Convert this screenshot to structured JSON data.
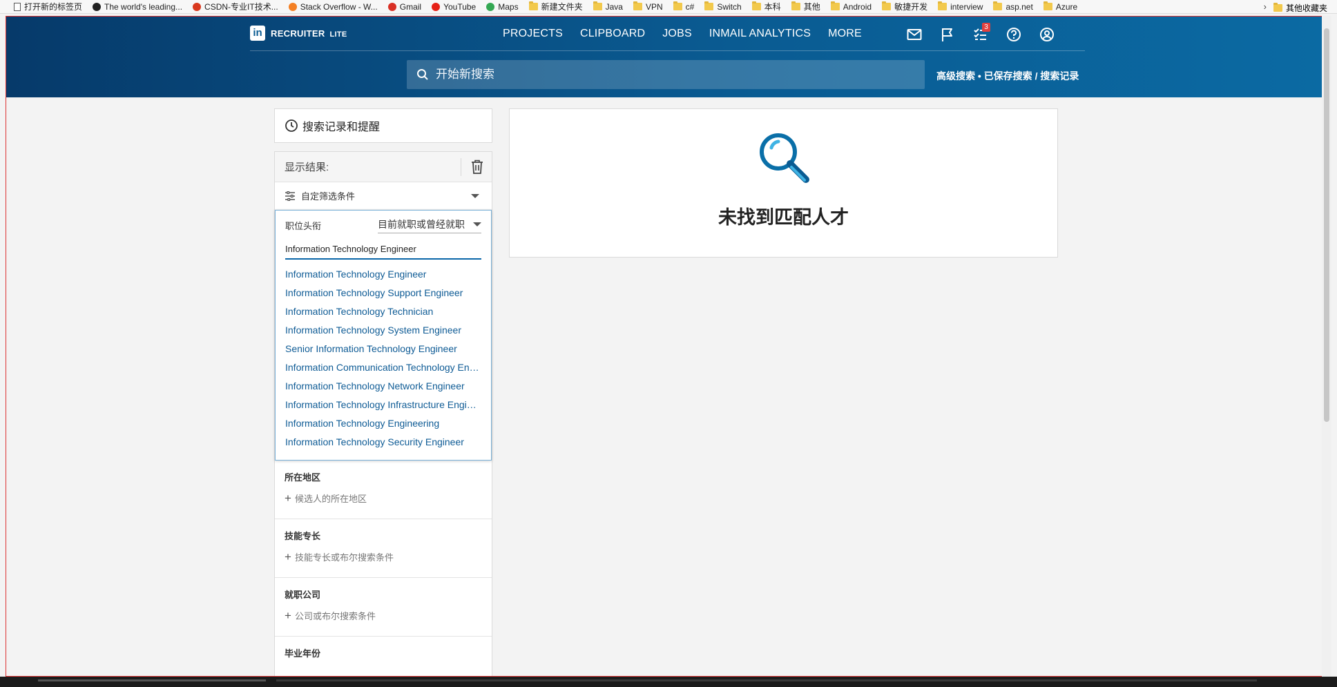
{
  "bookmarks": [
    {
      "label": "打开新的标签页",
      "icon": "page-icon"
    },
    {
      "label": "The world's leading...",
      "icon": "github-icon"
    },
    {
      "label": "CSDN-专业IT技术...",
      "icon": "csdn-icon"
    },
    {
      "label": "Stack Overflow - W...",
      "icon": "stackoverflow-icon"
    },
    {
      "label": "Gmail",
      "icon": "gmail-icon"
    },
    {
      "label": "YouTube",
      "icon": "youtube-icon"
    },
    {
      "label": "Maps",
      "icon": "maps-icon"
    },
    {
      "label": "新建文件夹",
      "icon": "folder-icon"
    },
    {
      "label": "Java",
      "icon": "folder-icon"
    },
    {
      "label": "VPN",
      "icon": "folder-icon"
    },
    {
      "label": "c#",
      "icon": "folder-icon"
    },
    {
      "label": "Switch",
      "icon": "folder-icon"
    },
    {
      "label": "本科",
      "icon": "folder-icon"
    },
    {
      "label": "其他",
      "icon": "folder-icon"
    },
    {
      "label": "Android",
      "icon": "folder-icon"
    },
    {
      "label": "敏捷开发",
      "icon": "folder-icon"
    },
    {
      "label": "interview",
      "icon": "folder-icon"
    },
    {
      "label": "asp.net",
      "icon": "folder-icon"
    },
    {
      "label": "Azure",
      "icon": "folder-icon"
    }
  ],
  "bookmarks_other": "其他收藏夹",
  "header": {
    "logo_in": "in",
    "brand": "RECRUITER",
    "brand_suffix": "LITE",
    "nav": [
      "PROJECTS",
      "CLIPBOARD",
      "JOBS",
      "INMAIL ANALYTICS",
      "MORE"
    ],
    "tasks_badge": "3",
    "search_placeholder": "开始新搜索",
    "search_links": {
      "advanced": "高级搜索",
      "dot": "•",
      "saved": "已保存搜索",
      "slash": "/",
      "history": "搜索记录"
    }
  },
  "sidebar": {
    "history_label": "搜索记录和提醒",
    "results_label": "显示结果:",
    "custom_filter_label": "自定筛选条件",
    "job_title": {
      "label": "职位头衔",
      "scope": "目前就职或曾经就职",
      "input_value": "Information Technology Engineer",
      "suggestions": [
        "Information Technology Engineer",
        "Information Technology Support Engineer",
        "Information Technology Technician",
        "Information Technology System Engineer",
        "Senior Information Technology Engineer",
        "Information Communication Technology Engineer",
        "Information Technology Network Engineer",
        "Information Technology Infrastructure Engineer",
        "Information Technology Engineering",
        "Information Technology Security Engineer"
      ]
    },
    "filters": [
      {
        "title": "所在地区",
        "add": "候选人的所在地区"
      },
      {
        "title": "技能专长",
        "add": "技能专长或布尔搜索条件"
      },
      {
        "title": "就职公司",
        "add": "公司或布尔搜索条件"
      },
      {
        "title": "毕业年份",
        "add": ""
      }
    ]
  },
  "main": {
    "no_match": "未找到匹配人才"
  },
  "colors": {
    "header_start": "#063a6a",
    "header_end": "#0b6aa3",
    "link_blue": "#0e5b95",
    "icon_blue": "#0a6fa8"
  }
}
